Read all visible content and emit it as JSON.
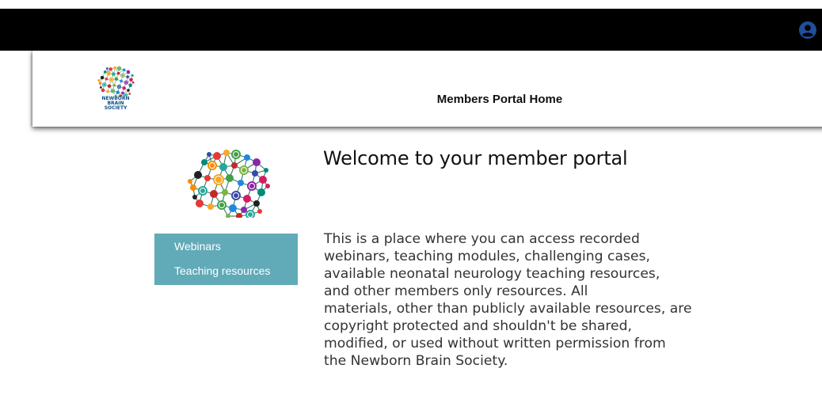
{
  "topbar": {
    "user_icon": "user-circle-icon",
    "color": "#000000",
    "icon_color": "#1f4e9c"
  },
  "header": {
    "logo_icon": "brain-network-logo",
    "logo_text_line1": "NEWBORN BRAIN",
    "logo_text_line2": "SOCIETY",
    "title": "Members Portal Home"
  },
  "sidebar": {
    "logo_icon": "brain-network-logo",
    "background": "#61aab8",
    "items": [
      {
        "label": "Webinars"
      },
      {
        "label": "Teaching resources"
      }
    ]
  },
  "main": {
    "heading": "Welcome to your member portal",
    "intro_lines": [
      "This is a place where you can access recorded",
      "webinars, teaching modules, challenging cases,",
      "available neonatal neurology teaching resources,",
      "and other members only resources. All",
      "materials, other than publicly available resources, are",
      "copyright protected and shouldn't be shared,",
      "modified, or used without written permission from",
      "the Newborn Brain Society."
    ]
  }
}
